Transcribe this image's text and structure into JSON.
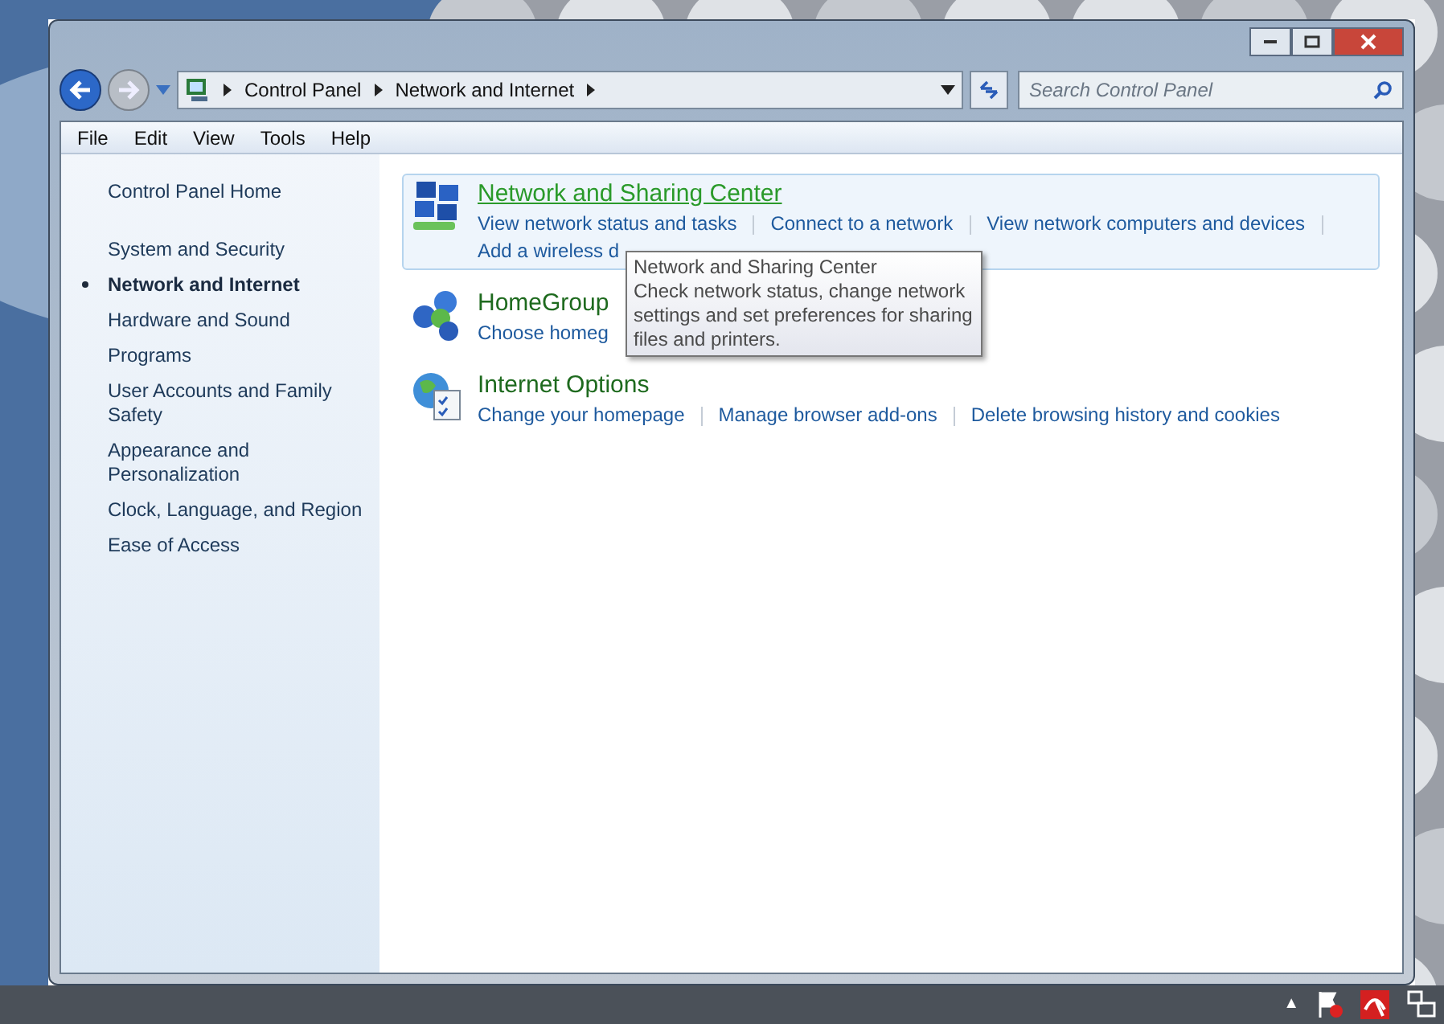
{
  "window": {
    "buttons": [
      {
        "kind": "minimize"
      },
      {
        "kind": "maximize"
      },
      {
        "kind": "close"
      }
    ]
  },
  "address_bar": {
    "crumbs": [
      "Control Panel",
      "Network and Internet"
    ]
  },
  "search": {
    "placeholder": "Search Control Panel"
  },
  "menu": [
    "File",
    "Edit",
    "View",
    "Tools",
    "Help"
  ],
  "sidebar": {
    "home": "Control Panel Home",
    "items": [
      {
        "label": "System and Security",
        "selected": false
      },
      {
        "label": "Network and Internet",
        "selected": true
      },
      {
        "label": "Hardware and Sound",
        "selected": false
      },
      {
        "label": "Programs",
        "selected": false
      },
      {
        "label": "User Accounts and Family Safety",
        "selected": false
      },
      {
        "label": "Appearance and Personalization",
        "selected": false
      },
      {
        "label": "Clock, Language, and Region",
        "selected": false
      },
      {
        "label": "Ease of Access",
        "selected": false
      }
    ]
  },
  "categories": [
    {
      "kind": "network",
      "title": "Network and Sharing Center",
      "highlighted": true,
      "links": [
        "View network status and tasks",
        "Connect to a network",
        "View network computers and devices",
        "Add a wireless d"
      ]
    },
    {
      "kind": "homegroup",
      "title": "HomeGroup",
      "highlighted": false,
      "links": [
        "Choose homeg"
      ]
    },
    {
      "kind": "internet",
      "title": "Internet Options",
      "highlighted": false,
      "links": [
        "Change your homepage",
        "Manage browser add-ons",
        "Delete browsing history and cookies"
      ]
    }
  ],
  "tooltip": {
    "title": "Network and Sharing Center",
    "text": "Check network status, change network settings and set preferences for sharing files and printers."
  },
  "tray": [
    {
      "kind": "arrow",
      "text": "▲"
    },
    {
      "kind": "flag"
    },
    {
      "kind": "umbrella"
    },
    {
      "kind": "network"
    }
  ]
}
